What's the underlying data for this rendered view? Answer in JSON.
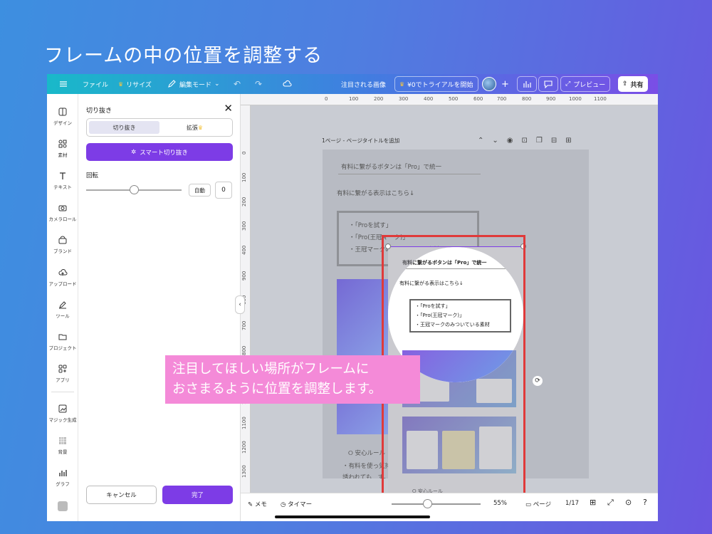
{
  "slide_title": "フレームの中の位置を調整する",
  "topbar": {
    "menu_icon": "hamburger-icon",
    "file": "ファイル",
    "resize": "リサイズ",
    "edit_mode": "編集モード",
    "featured_image": "注目される画像",
    "trial": "¥0でトライアルを開始",
    "add": "+",
    "preview": "プレビュー",
    "share": "共有"
  },
  "leftnav": [
    {
      "label": "デザイン",
      "icon": "design-icon"
    },
    {
      "label": "素材",
      "icon": "elements-icon"
    },
    {
      "label": "テキスト",
      "icon": "text-icon"
    },
    {
      "label": "カメラロール",
      "icon": "camera-icon"
    },
    {
      "label": "ブランド",
      "icon": "brand-icon"
    },
    {
      "label": "アップロード",
      "icon": "upload-icon"
    },
    {
      "label": "ツール",
      "icon": "tools-icon"
    },
    {
      "label": "プロジェクト",
      "icon": "folder-icon"
    },
    {
      "label": "アプリ",
      "icon": "apps-icon"
    },
    {
      "label": "マジック生成",
      "icon": "magic-icon"
    },
    {
      "label": "背景",
      "icon": "background-icon"
    },
    {
      "label": "グラフ",
      "icon": "chart-icon"
    }
  ],
  "panel": {
    "title": "切り抜き",
    "tab_crop": "切り抜き",
    "tab_expand": "拡張",
    "smart_crop": "スマート切り抜き",
    "rotation_label": "回転",
    "rotation_auto": "自動",
    "rotation_value": "0",
    "rotation_level": 0.5,
    "cancel": "キャンセル",
    "done": "完了"
  },
  "ruler_top": [
    "0",
    "100",
    "200",
    "300",
    "400",
    "500",
    "600",
    "700",
    "800",
    "900",
    "1000",
    "1100"
  ],
  "ruler_left": [
    "0",
    "100",
    "200",
    "300",
    "400",
    "900",
    "600",
    "700",
    "800",
    "1000",
    "1100",
    "1200",
    "1300"
  ],
  "page_header": "1ページ - ページタイトルを追加",
  "page_content": {
    "heading": "有料に繋がるボタンは「Pro」で統一",
    "subheading": "有料に繋がる表示はこちら↓",
    "list": [
      "・「Proを試す」",
      "・「Pro(王冠マーク)」",
      "・王冠マークのみついている素材"
    ],
    "rule_title": "安心ルール",
    "rule_line1": "・有料を使っ気持ちがなくも気",
    "rule_line2": "誘われても　ず。でもどる"
  },
  "frame_content": {
    "heading": "有料に繋がるボタンは「Pro」で統一",
    "subheading": "有料に繋がる表示はこちら↓",
    "list": [
      "・「Proを試す」",
      "・「Pro(王冠マーク)」",
      "・王冠マークのみついている素材"
    ],
    "rule_title": "安心ルール"
  },
  "bottombar": {
    "memo": "メモ",
    "timer": "タイマー",
    "zoom": "55%",
    "zoom_level": 0.4,
    "pages": "ページ",
    "page_count": "1/17"
  },
  "callout": {
    "line1": "注目してほしい場所がフレームに",
    "line2": "おさまるように位置を調整します。"
  },
  "colors": {
    "accent_purple": "#7d3ce6",
    "highlight_red": "#e03a3a",
    "callout_pink": "#f48ad8",
    "crown_gold": "#f5c542"
  }
}
